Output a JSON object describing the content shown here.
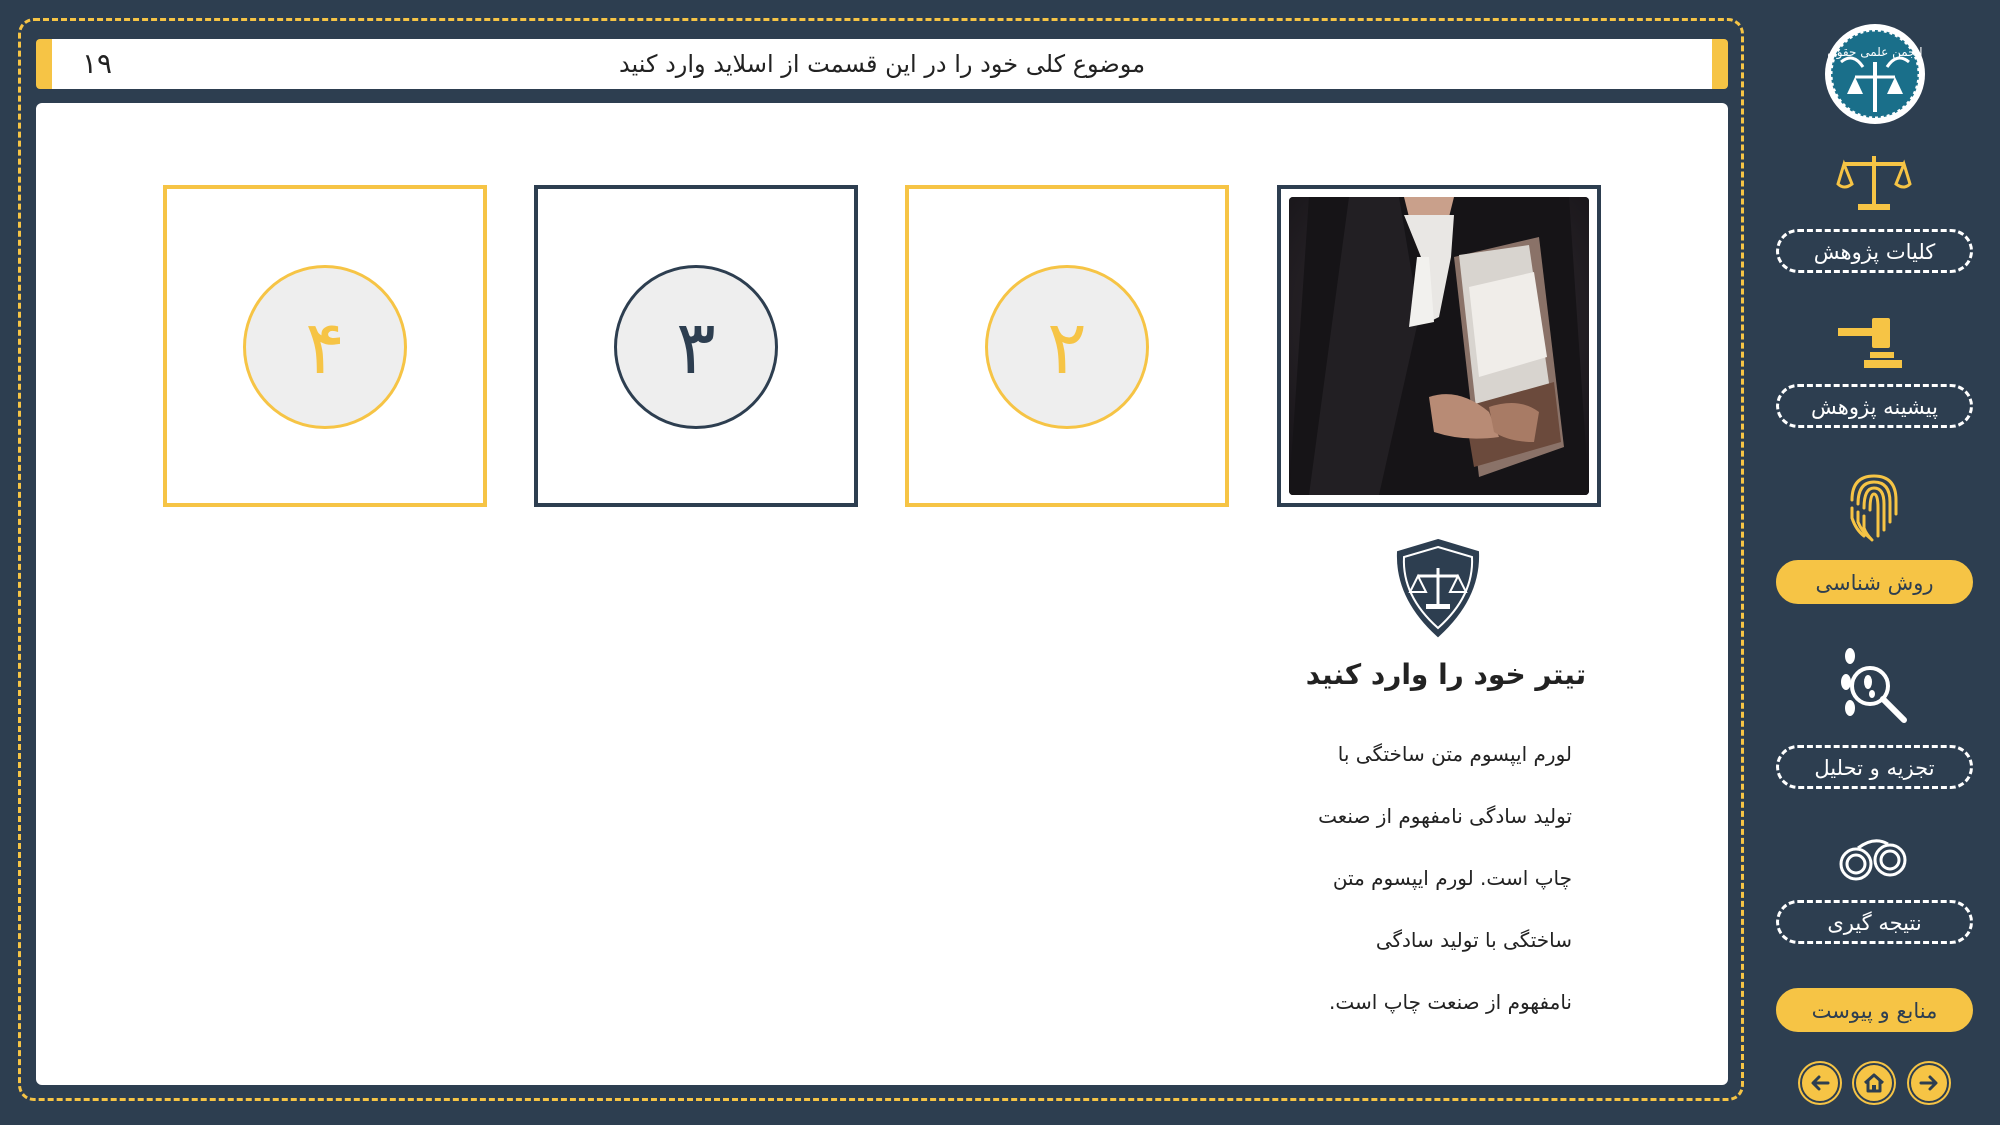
{
  "header": {
    "title": "موضوع کلی خود را در این قسمت از اسلاید وارد کنید",
    "page_number": "۱۹"
  },
  "cards": [
    {
      "label": "۴",
      "style": "yellow"
    },
    {
      "label": "۳",
      "style": "navy"
    },
    {
      "label": "۲",
      "style": "yellow"
    }
  ],
  "content": {
    "subtitle": "تیتر خود را وارد کنید",
    "body_lines": [
      "لورم ایپسوم متن ساختگی با",
      "تولید سادگی نامفهوم از صنعت",
      "چاپ است. لورم ایپسوم متن",
      "ساختگی با تولید سادگی",
      "نامفهوم از صنعت چاپ است."
    ]
  },
  "sidebar": {
    "items": [
      {
        "label": "کلیات پژوهش",
        "icon": "scales-icon",
        "active": false
      },
      {
        "label": "پیشینه پژوهش",
        "icon": "gavel-icon",
        "active": false
      },
      {
        "label": "روش شناسی",
        "icon": "fingerprint-icon",
        "active": true
      },
      {
        "label": "تجزیه و تحلیل",
        "icon": "magnifier-footprints-icon",
        "active": false
      },
      {
        "label": "نتیجه گیری",
        "icon": "handcuffs-icon",
        "active": false
      },
      {
        "label": "منابع و پیوست",
        "icon": "",
        "active": true
      }
    ],
    "logo_text": "انجمن علمی حقوق"
  },
  "colors": {
    "accent": "#f6c445",
    "navy": "#2d3e50",
    "white": "#ffffff"
  }
}
